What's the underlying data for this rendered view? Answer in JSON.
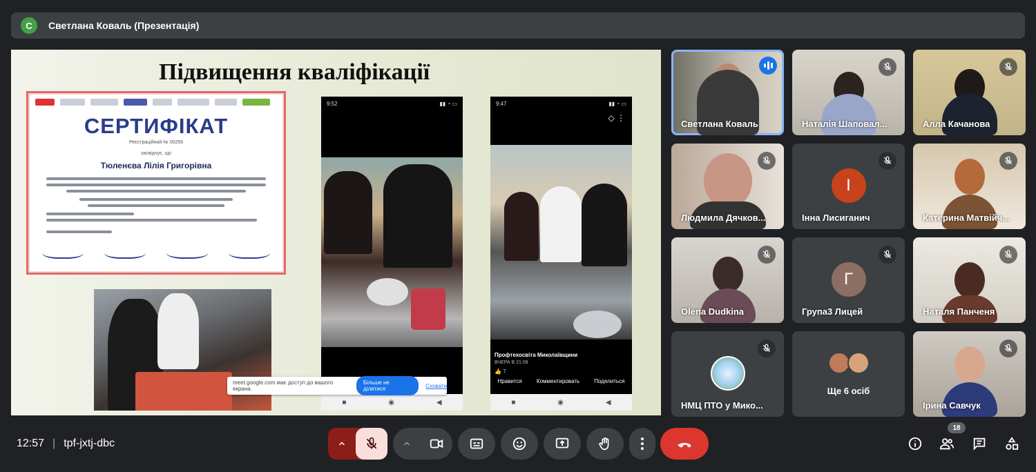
{
  "presenter": {
    "initial": "С",
    "title": "Светлана Коваль (Презентація)"
  },
  "slide": {
    "title": "Підвищення кваліфікації",
    "certificate": {
      "heading": "СЕРТИФІКАТ",
      "reg": "Реєстраційний № 00256",
      "confirms": "засвідчує, що",
      "name": "Тюленєва Лілія Григорівна"
    },
    "phone1": {
      "time": "9:52"
    },
    "phone2": {
      "time": "9:47",
      "post_title": "Профтехосвіта Миколаївщини",
      "post_time": "ВЧЕРА В 21:08",
      "likes": "7",
      "actions": [
        "Нравится",
        "Комментировать",
        "Поделиться"
      ]
    },
    "toast": {
      "text": "meet.google.com має доступ до вашого екрана.",
      "stop": "Більше не ділитися",
      "hide": "Сховати"
    }
  },
  "participants": [
    {
      "name": "Светлана Коваль",
      "speaking": true
    },
    {
      "name": "Наталія Шаповал..."
    },
    {
      "name": "Алла Качанова"
    },
    {
      "name": "Людмила Дячков..."
    },
    {
      "name": "Інна Лисиганич",
      "initial": "І"
    },
    {
      "name": "Катерина Матвійч..."
    },
    {
      "name": "Olena Dudkina"
    },
    {
      "name": "Група3 Лицей",
      "initial": "Г"
    },
    {
      "name": "Наталя Панченя"
    },
    {
      "name": "НМЦ ПТО у Мико..."
    },
    {
      "name": "Ще 6 осіб"
    },
    {
      "name": "Ірина Савчук"
    }
  ],
  "meeting": {
    "time": "12:57",
    "code": "tpf-jxtj-dbc",
    "people_count": "18"
  },
  "colors": {
    "accent": "#1a73e8",
    "danger": "#ea4335",
    "mic_off_bg": "#f9dedc"
  },
  "icons": [
    "mic-off-icon",
    "camera-icon",
    "captions-icon",
    "emoji-icon",
    "present-icon",
    "hand-icon",
    "more-icon",
    "end-call-icon",
    "info-icon",
    "people-icon",
    "chat-icon",
    "activities-icon"
  ]
}
